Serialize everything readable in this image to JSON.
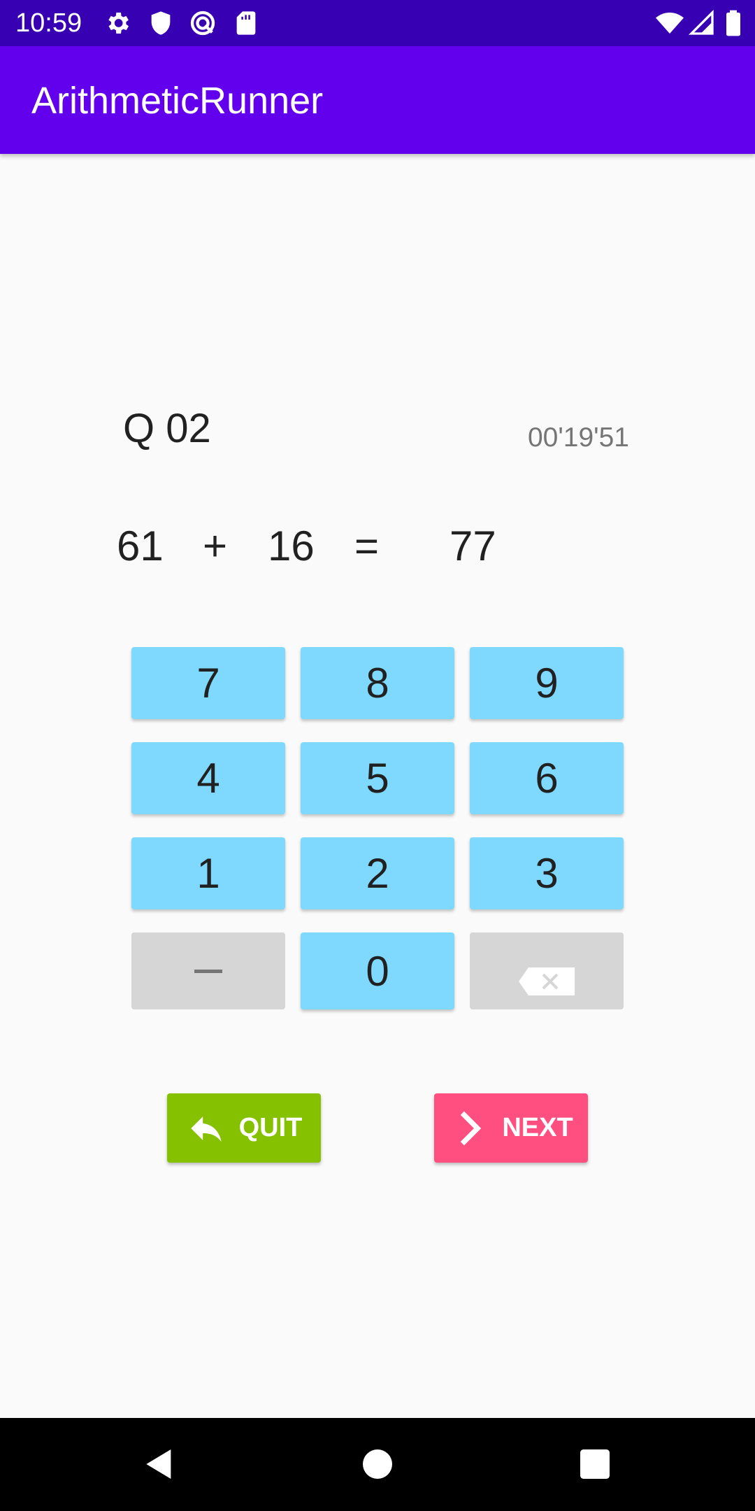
{
  "status_bar": {
    "time": "10:59",
    "icons_left": [
      "settings-icon",
      "shield-icon",
      "sync-icon",
      "sd-card-icon"
    ],
    "icons_right": [
      "wifi-icon",
      "signal-icon",
      "battery-icon"
    ]
  },
  "app_bar": {
    "title": "ArithmeticRunner"
  },
  "question": {
    "label": "Q 02",
    "timer": "00'19'51"
  },
  "equation": {
    "operand1": "61",
    "operator": "+",
    "operand2": "16",
    "equals": "=",
    "answer": "77"
  },
  "keypad": {
    "keys": [
      "7",
      "8",
      "9",
      "4",
      "5",
      "6",
      "1",
      "2",
      "3"
    ],
    "minus_icon": "minus-icon",
    "zero": "0",
    "backspace_icon": "backspace-icon"
  },
  "actions": {
    "quit_label": "QUIT",
    "next_label": "NEXT"
  },
  "colors": {
    "status_bar": "#3700b3",
    "app_bar": "#6200ee",
    "key": "#7fd8fd",
    "key_gray": "#d6d6d6",
    "quit": "#86c100",
    "next": "#ff4f80"
  }
}
